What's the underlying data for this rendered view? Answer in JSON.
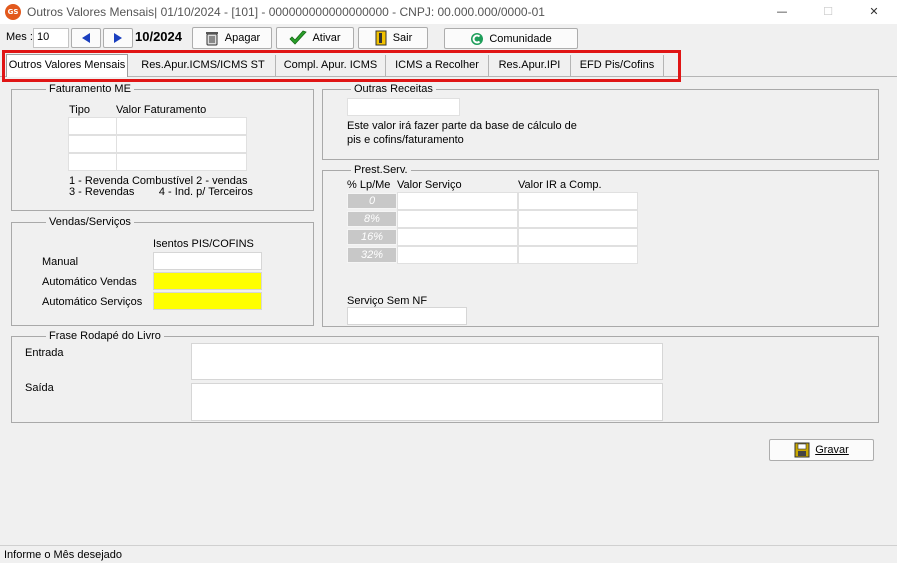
{
  "window": {
    "title": "Outros Valores Mensais|  01/10/2024 - [101] - 000000000000000000 - CNPJ: 00.000.000/0000-01",
    "app_icon_text": "GS",
    "minimize": "—",
    "maximize": "☐",
    "close": "✕"
  },
  "toolbar": {
    "mes_label": "Mes :",
    "mes_value": "10",
    "period": "10/2024",
    "apagar": "Apagar",
    "ativar": "Ativar",
    "sair": "Sair",
    "comunidade": "Comunidade"
  },
  "tabs": [
    {
      "label": "Outros Valores Mensais",
      "active": true
    },
    {
      "label": "Res.Apur.ICMS/ICMS ST"
    },
    {
      "label": "Compl. Apur. ICMS"
    },
    {
      "label": "ICMS a Recolher"
    },
    {
      "label": "Res.Apur.IPI"
    },
    {
      "label": "EFD Pis/Cofins"
    }
  ],
  "faturamento": {
    "title": "Faturamento  ME",
    "col_tipo": "Tipo",
    "col_valor": "Valor Faturamento",
    "legend1": "1 - Revenda Combustível  2 - vendas",
    "legend2": "3 - Revendas        4 - Ind. p/ Terceiros"
  },
  "outras": {
    "title": "Outras Receitas",
    "note1": "Este valor irá fazer parte da base de cálculo de",
    "note2": "pis e cofins/faturamento"
  },
  "vendas": {
    "title": "Vendas/Serviços",
    "isentos": "Isentos PIS/COFINS",
    "manual": "Manual",
    "auto_vendas": "Automático Vendas",
    "auto_servicos": "Automático Serviços"
  },
  "prest": {
    "title": "Prest.Serv.",
    "col_lp": "% Lp/Me",
    "col_valor": "Valor Serviço",
    "col_ir": "Valor IR a Comp.",
    "rates": [
      "0",
      "8%",
      "16%",
      "32%"
    ],
    "sem_nf": "Serviço Sem NF"
  },
  "frase": {
    "title": "Frase Rodapé do Livro",
    "entrada": "Entrada",
    "saida": "Saída"
  },
  "gravar": "Gravar",
  "status": "Informe o Mês desejado"
}
